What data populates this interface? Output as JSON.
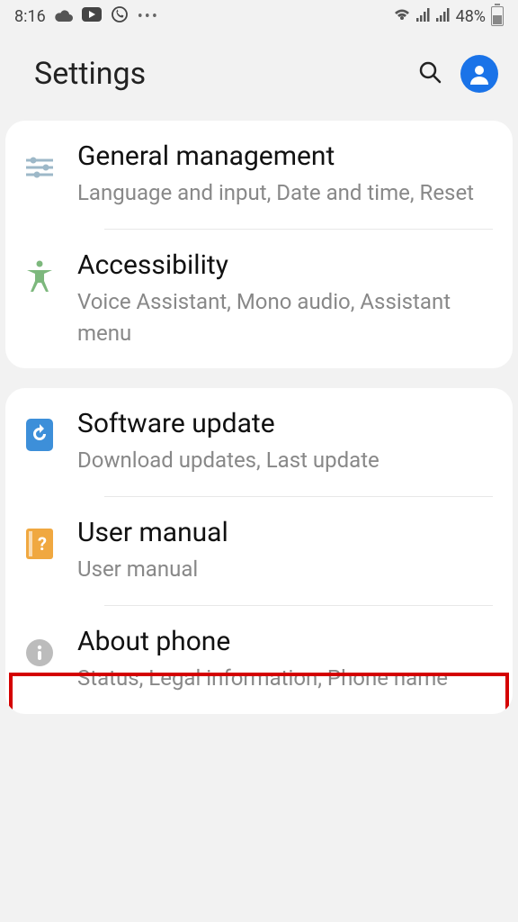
{
  "status_bar": {
    "time": "8:16",
    "battery_percent": "48%"
  },
  "header": {
    "title": "Settings"
  },
  "groups": [
    {
      "items": [
        {
          "title": "General management",
          "subtitle": "Language and input, Date and time, Reset"
        },
        {
          "title": "Accessibility",
          "subtitle": "Voice Assistant, Mono audio, Assistant menu"
        }
      ]
    },
    {
      "items": [
        {
          "title": "Software update",
          "subtitle": "Download updates, Last update"
        },
        {
          "title": "User manual",
          "subtitle": "User manual"
        },
        {
          "title": "About phone",
          "subtitle": "Status, Legal information, Phone name"
        }
      ]
    }
  ]
}
